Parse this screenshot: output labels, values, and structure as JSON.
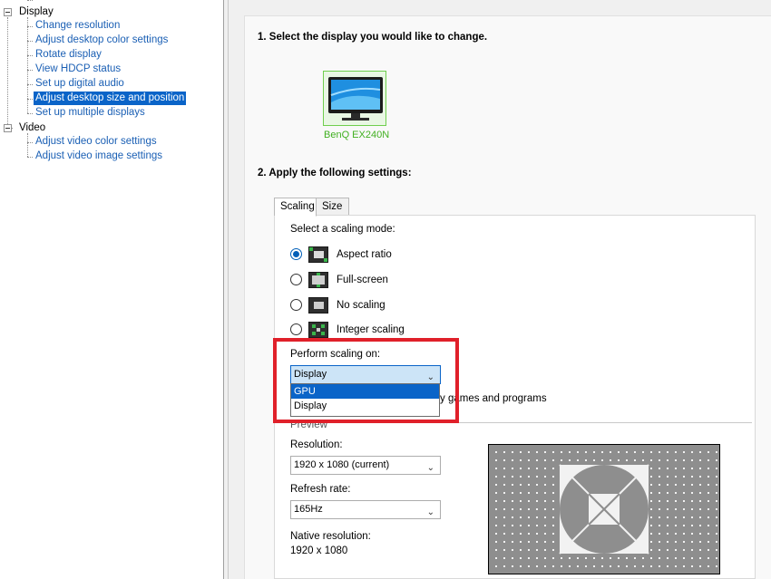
{
  "tree": {
    "categories": {
      "display": "Display",
      "video": "Video"
    },
    "display_items": [
      "Change resolution",
      "Adjust desktop color settings",
      "Rotate display",
      "View HDCP status",
      "Set up digital audio",
      "Adjust desktop size and position",
      "Set up multiple displays"
    ],
    "video_items": [
      "Adjust video color settings",
      "Adjust video image settings"
    ],
    "selected": "Adjust desktop size and position"
  },
  "content": {
    "step1_title": "1. Select the display you would like to change.",
    "monitor_name": "BenQ EX240N",
    "step2_title": "2. Apply the following settings:",
    "tabs": [
      "Scaling",
      "Size"
    ],
    "active_tab": "Scaling",
    "scaling_mode_label": "Select a scaling mode:",
    "modes": [
      {
        "label": "Aspect ratio",
        "checked": true,
        "icon": "aspect-ratio-icon"
      },
      {
        "label": "Full-screen",
        "checked": false,
        "icon": "full-screen-icon"
      },
      {
        "label": "No scaling",
        "checked": false,
        "icon": "no-scaling-icon"
      },
      {
        "label": "Integer scaling",
        "checked": false,
        "icon": "integer-scaling-icon"
      }
    ],
    "perform_scaling_label": "Perform scaling on:",
    "perform_scaling_value": "Display",
    "perform_scaling_options": [
      "GPU",
      "Display"
    ],
    "highlighted_option": "GPU",
    "override_text_partial": "y games and programs",
    "preview_label": "Preview",
    "resolution_label": "Resolution:",
    "resolution_value": "1920 x 1080 (current)",
    "refresh_label": "Refresh rate:",
    "refresh_value": "165Hz",
    "native_label": "Native resolution:",
    "native_value": "1920 x 1080"
  },
  "colors": {
    "selection": "#0a64c8",
    "link": "#1a5fb4",
    "nvidia_green": "#41b021",
    "highlight_box": "#e0202a"
  }
}
